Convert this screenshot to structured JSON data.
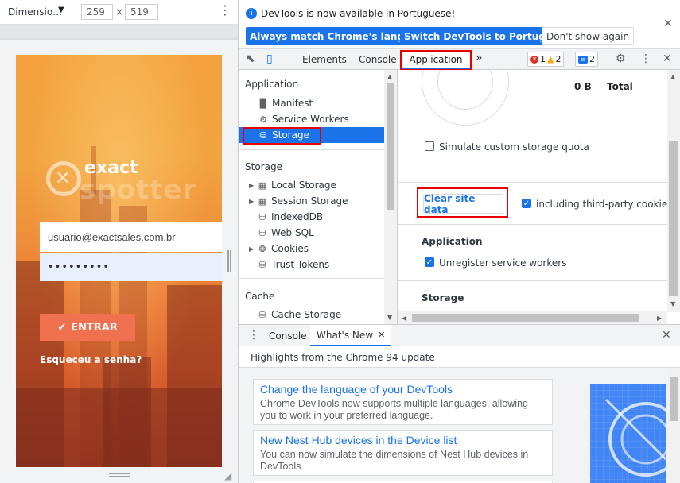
{
  "device_toolbar": {
    "mode": "Dimensio…",
    "width": "259",
    "times": "×",
    "height": "519"
  },
  "phone": {
    "brand_top": "exact",
    "brand_bottom": "spotter",
    "email": "usuario@exactsales.com.br",
    "password": "•••••••••",
    "login_button": "ENTRAR",
    "forgot": "Esqueceu a senha?"
  },
  "infobar": {
    "message": "DevTools is now available in Portuguese!",
    "btn_match": "Always match Chrome's language",
    "btn_switch": "Switch DevTools to Portuguese",
    "btn_dont_show": "Don't show again"
  },
  "tabs": {
    "elements": "Elements",
    "console": "Console",
    "application": "Application",
    "more": "»",
    "errors": "1",
    "warnings": "2",
    "messages": "2"
  },
  "sidebar": {
    "application_heading": "Application",
    "application_items": [
      {
        "label": "Manifest",
        "icon": "file-icon"
      },
      {
        "label": "Service Workers",
        "icon": "gear-icon"
      },
      {
        "label": "Storage",
        "icon": "database-icon"
      }
    ],
    "storage_heading": "Storage",
    "storage_items": [
      {
        "label": "Local Storage",
        "icon": "table-icon"
      },
      {
        "label": "Session Storage",
        "icon": "table-icon"
      },
      {
        "label": "IndexedDB",
        "icon": "database-icon"
      },
      {
        "label": "Web SQL",
        "icon": "database-icon"
      },
      {
        "label": "Cookies",
        "icon": "cookie-icon"
      },
      {
        "label": "Trust Tokens",
        "icon": "database-icon"
      }
    ],
    "cache_heading": "Cache",
    "cache_items": [
      {
        "label": "Cache Storage",
        "icon": "database-icon"
      }
    ]
  },
  "storage_panel": {
    "usage_value": "0 B",
    "usage_total": "Total",
    "simulate_quota": "Simulate custom storage quota",
    "clear_button": "Clear site data",
    "including_third_party": "including third-party cookies",
    "application_heading": "Application",
    "unregister_sw": "Unregister service workers",
    "storage_heading": "Storage"
  },
  "drawer": {
    "console_tab": "Console",
    "whats_new_tab": "What's New",
    "highlights": "Highlights from the Chrome 94 update",
    "cards": [
      {
        "title": "Change the language of your DevTools",
        "desc": "Chrome DevTools now supports multiple languages, allowing you to work in your preferred language."
      },
      {
        "title": "New Nest Hub devices in the Device list",
        "desc": "You can now simulate the dimensions of Nest Hub devices in DevTools."
      }
    ]
  },
  "colors": {
    "accent": "#1a73e8",
    "highlight_box": "#e60000",
    "login_button": "#f0714f"
  }
}
